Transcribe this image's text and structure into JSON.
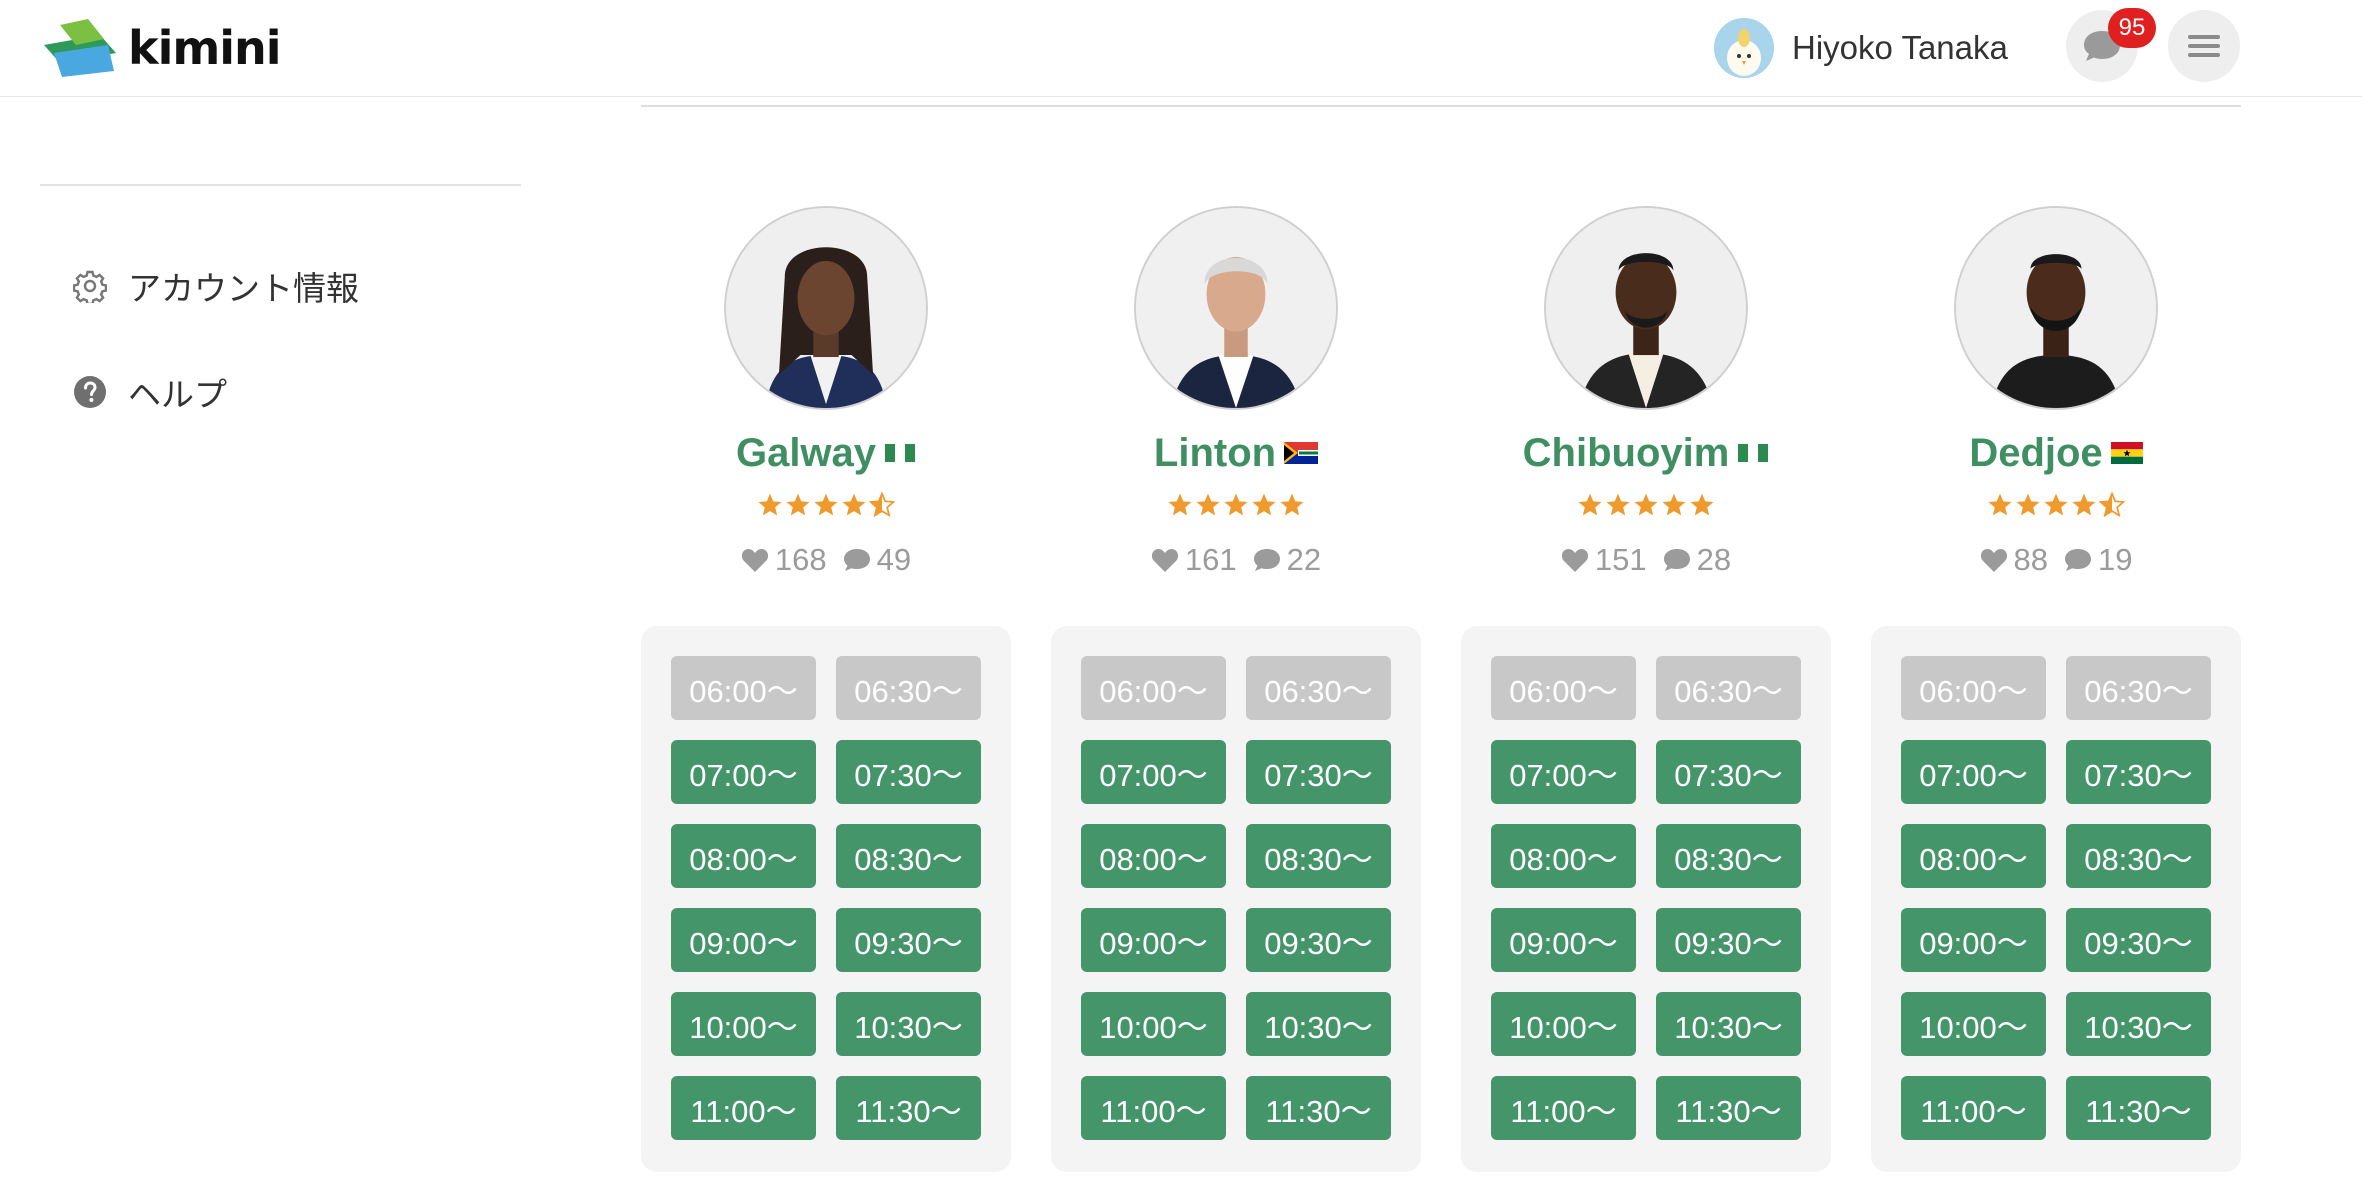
{
  "header": {
    "logo_text": "kimini",
    "user_name": "Hiyoko Tanaka",
    "notification_count": "95",
    "icons": {
      "chat": "chat-bubble-icon",
      "menu": "hamburger-menu-icon"
    }
  },
  "sidebar": {
    "items": [
      {
        "label": "アカウント情報",
        "icon": "gear-icon"
      },
      {
        "label": "ヘルプ",
        "icon": "question-icon"
      }
    ]
  },
  "colors": {
    "green": "#45956a",
    "name_green": "#3f8f63",
    "slot_closed": "#c8c8c8",
    "star": "#ee9a2c",
    "badge": "#e02020"
  },
  "tutors": [
    {
      "name": "Galway",
      "flag": "nigeria",
      "rating": 4.5,
      "likes": "168",
      "comments": "49",
      "slots": [
        {
          "label": "06:00〜",
          "available": false
        },
        {
          "label": "06:30〜",
          "available": false
        },
        {
          "label": "07:00〜",
          "available": true
        },
        {
          "label": "07:30〜",
          "available": true
        },
        {
          "label": "08:00〜",
          "available": true
        },
        {
          "label": "08:30〜",
          "available": true
        },
        {
          "label": "09:00〜",
          "available": true
        },
        {
          "label": "09:30〜",
          "available": true
        },
        {
          "label": "10:00〜",
          "available": true
        },
        {
          "label": "10:30〜",
          "available": true
        },
        {
          "label": "11:00〜",
          "available": true
        },
        {
          "label": "11:30〜",
          "available": true
        }
      ]
    },
    {
      "name": "Linton",
      "flag": "south-africa",
      "rating": 5,
      "likes": "161",
      "comments": "22",
      "slots": [
        {
          "label": "06:00〜",
          "available": false
        },
        {
          "label": "06:30〜",
          "available": false
        },
        {
          "label": "07:00〜",
          "available": true
        },
        {
          "label": "07:30〜",
          "available": true
        },
        {
          "label": "08:00〜",
          "available": true
        },
        {
          "label": "08:30〜",
          "available": true
        },
        {
          "label": "09:00〜",
          "available": true
        },
        {
          "label": "09:30〜",
          "available": true
        },
        {
          "label": "10:00〜",
          "available": true
        },
        {
          "label": "10:30〜",
          "available": true
        },
        {
          "label": "11:00〜",
          "available": true
        },
        {
          "label": "11:30〜",
          "available": true
        }
      ]
    },
    {
      "name": "Chibuoyim",
      "flag": "nigeria",
      "rating": 5,
      "likes": "151",
      "comments": "28",
      "slots": [
        {
          "label": "06:00〜",
          "available": false
        },
        {
          "label": "06:30〜",
          "available": false
        },
        {
          "label": "07:00〜",
          "available": true
        },
        {
          "label": "07:30〜",
          "available": true
        },
        {
          "label": "08:00〜",
          "available": true
        },
        {
          "label": "08:30〜",
          "available": true
        },
        {
          "label": "09:00〜",
          "available": true
        },
        {
          "label": "09:30〜",
          "available": true
        },
        {
          "label": "10:00〜",
          "available": true
        },
        {
          "label": "10:30〜",
          "available": true
        },
        {
          "label": "11:00〜",
          "available": true
        },
        {
          "label": "11:30〜",
          "available": true
        }
      ]
    },
    {
      "name": "Dedjoe",
      "flag": "ghana",
      "rating": 4.5,
      "likes": "88",
      "comments": "19",
      "slots": [
        {
          "label": "06:00〜",
          "available": false
        },
        {
          "label": "06:30〜",
          "available": false
        },
        {
          "label": "07:00〜",
          "available": true
        },
        {
          "label": "07:30〜",
          "available": true
        },
        {
          "label": "08:00〜",
          "available": true
        },
        {
          "label": "08:30〜",
          "available": true
        },
        {
          "label": "09:00〜",
          "available": true
        },
        {
          "label": "09:30〜",
          "available": true
        },
        {
          "label": "10:00〜",
          "available": true
        },
        {
          "label": "10:30〜",
          "available": true
        },
        {
          "label": "11:00〜",
          "available": true
        },
        {
          "label": "11:30〜",
          "available": true
        }
      ]
    }
  ]
}
